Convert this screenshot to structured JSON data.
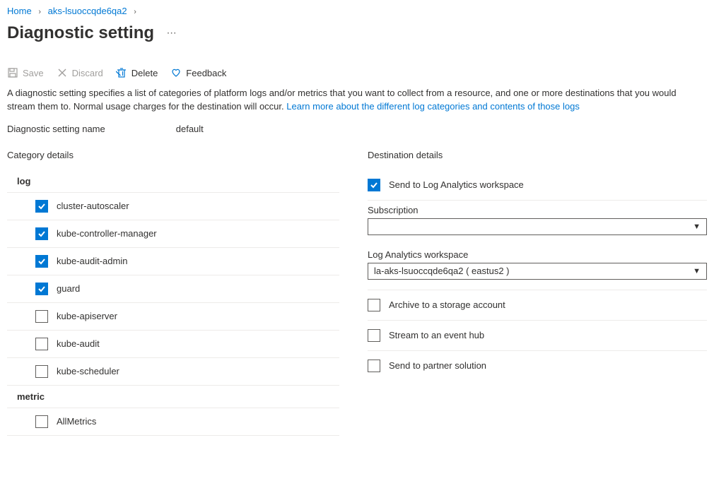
{
  "breadcrumb": {
    "home": "Home",
    "resource": "aks-lsuoccqde6qa2"
  },
  "title": "Diagnostic setting",
  "toolbar": {
    "save": "Save",
    "discard": "Discard",
    "delete": "Delete",
    "feedback": "Feedback"
  },
  "description": {
    "text": "A diagnostic setting specifies a list of categories of platform logs and/or metrics that you want to collect from a resource, and one or more destinations that you would stream them to. Normal usage charges for the destination will occur. ",
    "link": "Learn more about the different log categories and contents of those logs"
  },
  "setting_name": {
    "label": "Diagnostic setting name",
    "value": "default"
  },
  "category_details_label": "Category details",
  "destination_details_label": "Destination details",
  "groups": {
    "log_label": "log",
    "metric_label": "metric",
    "logs": [
      {
        "id": "cluster-autoscaler",
        "label": "cluster-autoscaler",
        "checked": true
      },
      {
        "id": "kube-controller-manager",
        "label": "kube-controller-manager",
        "checked": true
      },
      {
        "id": "kube-audit-admin",
        "label": "kube-audit-admin",
        "checked": true
      },
      {
        "id": "guard",
        "label": "guard",
        "checked": true
      },
      {
        "id": "kube-apiserver",
        "label": "kube-apiserver",
        "checked": false
      },
      {
        "id": "kube-audit",
        "label": "kube-audit",
        "checked": false
      },
      {
        "id": "kube-scheduler",
        "label": "kube-scheduler",
        "checked": false
      }
    ],
    "metrics": [
      {
        "id": "allmetrics",
        "label": "AllMetrics",
        "checked": false
      }
    ]
  },
  "destinations": {
    "log_analytics": {
      "label": "Send to Log Analytics workspace",
      "checked": true,
      "subscription_label": "Subscription",
      "subscription_value": "",
      "workspace_label": "Log Analytics workspace",
      "workspace_value": "la-aks-lsuoccqde6qa2 ( eastus2 )"
    },
    "storage": {
      "label": "Archive to a storage account",
      "checked": false
    },
    "eventhub": {
      "label": "Stream to an event hub",
      "checked": false
    },
    "partner": {
      "label": "Send to partner solution",
      "checked": false
    }
  }
}
